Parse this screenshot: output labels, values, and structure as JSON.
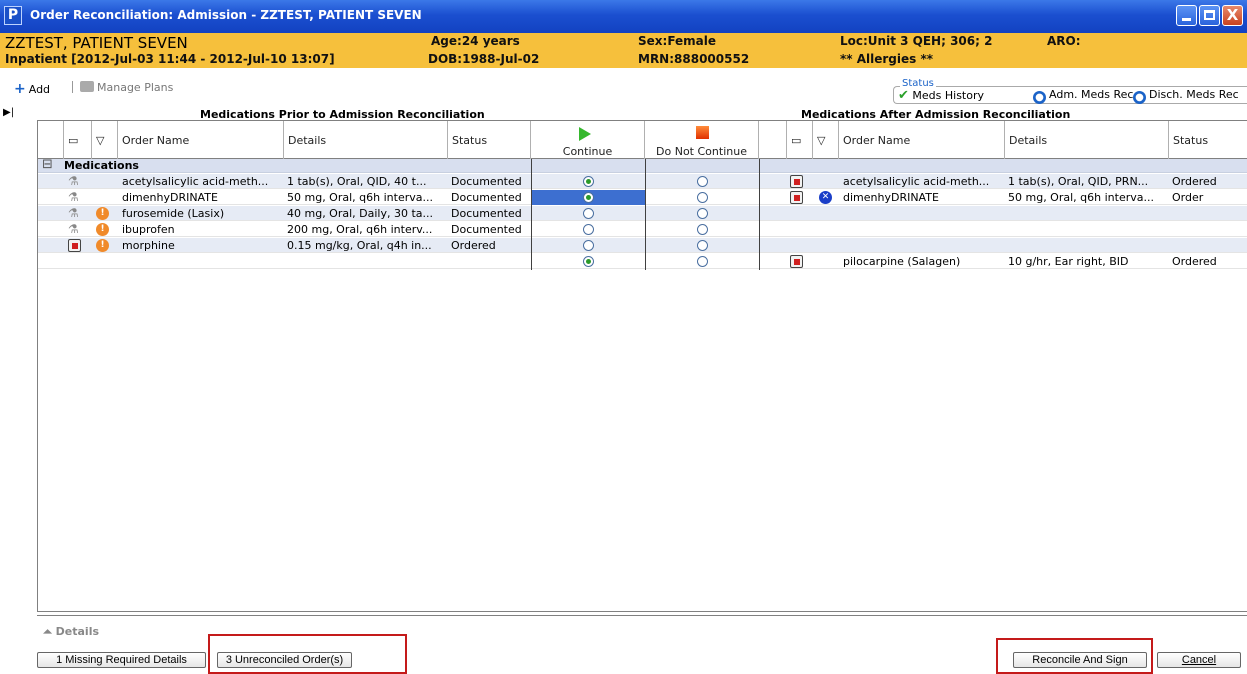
{
  "window": {
    "app_icon": "P",
    "title": "Order Reconciliation:  Admission - ZZTEST, PATIENT SEVEN",
    "min": "minimize-icon",
    "max": "maximize-icon",
    "close": "close-icon",
    "close_glyph": "X"
  },
  "banner": {
    "name": "ZZTEST, PATIENT SEVEN",
    "encounter": "Inpatient [2012-Jul-03 11:44 - 2012-Jul-10 13:07]",
    "age": "Age:24 years",
    "dob": "DOB:1988-Jul-02",
    "sex": "Sex:Female",
    "mrn": "MRN:888000552",
    "loc": "Loc:Unit 3 QEH; 306; 2",
    "allergies": "** Allergies **",
    "aro": "ARO:"
  },
  "toolbar": {
    "add": "Add",
    "manage_plans": "Manage Plans"
  },
  "status_legend": {
    "label": "Status",
    "meds_history": "Meds History",
    "adm": "Adm. Meds Rec",
    "disch": "Disch. Meds Rec"
  },
  "sections": {
    "left": "Medications Prior to Admission Reconciliation",
    "right": "Medications After Admission Reconciliation"
  },
  "headers": {
    "order_name": "Order Name",
    "details": "Details",
    "status": "Status",
    "continue": "Continue",
    "do_not_continue": "Do Not Continue"
  },
  "group": "Medications",
  "rows": [
    {
      "name": "acetylsalicylic acid-meth...",
      "details": "1 tab(s), Oral, QID, 40 t...",
      "status": "Documented",
      "continue": true,
      "right_name": "acetylsalicylic acid-meth...",
      "right_details": "1 tab(s), Oral, QID, PRN...",
      "right_status": "Ordered"
    },
    {
      "name": "dimenhyDRINATE",
      "details": "50 mg, Oral, q6h interva...",
      "status": "Documented",
      "continue": true,
      "right_name": "dimenhyDRINATE",
      "right_details": "50 mg, Oral, q6h interva...",
      "right_status": "Order"
    },
    {
      "name": "furosemide (Lasix)",
      "details": "40 mg, Oral, Daily, 30 ta...",
      "status": "Documented",
      "continue": false,
      "right_name": "",
      "right_details": "",
      "right_status": ""
    },
    {
      "name": "ibuprofen",
      "details": "200 mg, Oral, q6h interv...",
      "status": "Documented",
      "continue": false,
      "right_name": "",
      "right_details": "",
      "right_status": ""
    },
    {
      "name": "morphine",
      "details": "0.15 mg/kg, Oral, q4h in...",
      "status": "Ordered",
      "continue": false,
      "right_name": "",
      "right_details": "",
      "right_status": ""
    },
    {
      "name": "",
      "details": "",
      "status": "",
      "continue": true,
      "right_name": "pilocarpine (Salagen)",
      "right_details": "10 g/hr, Ear right, BID",
      "right_status": "Ordered"
    }
  ],
  "details_label": "Details",
  "buttons": {
    "missing": "1 Missing Required Details",
    "unreconciled": "3 Unreconciled Order(s)",
    "reconcile": "Reconcile And Sign",
    "cancel": "Cancel"
  }
}
